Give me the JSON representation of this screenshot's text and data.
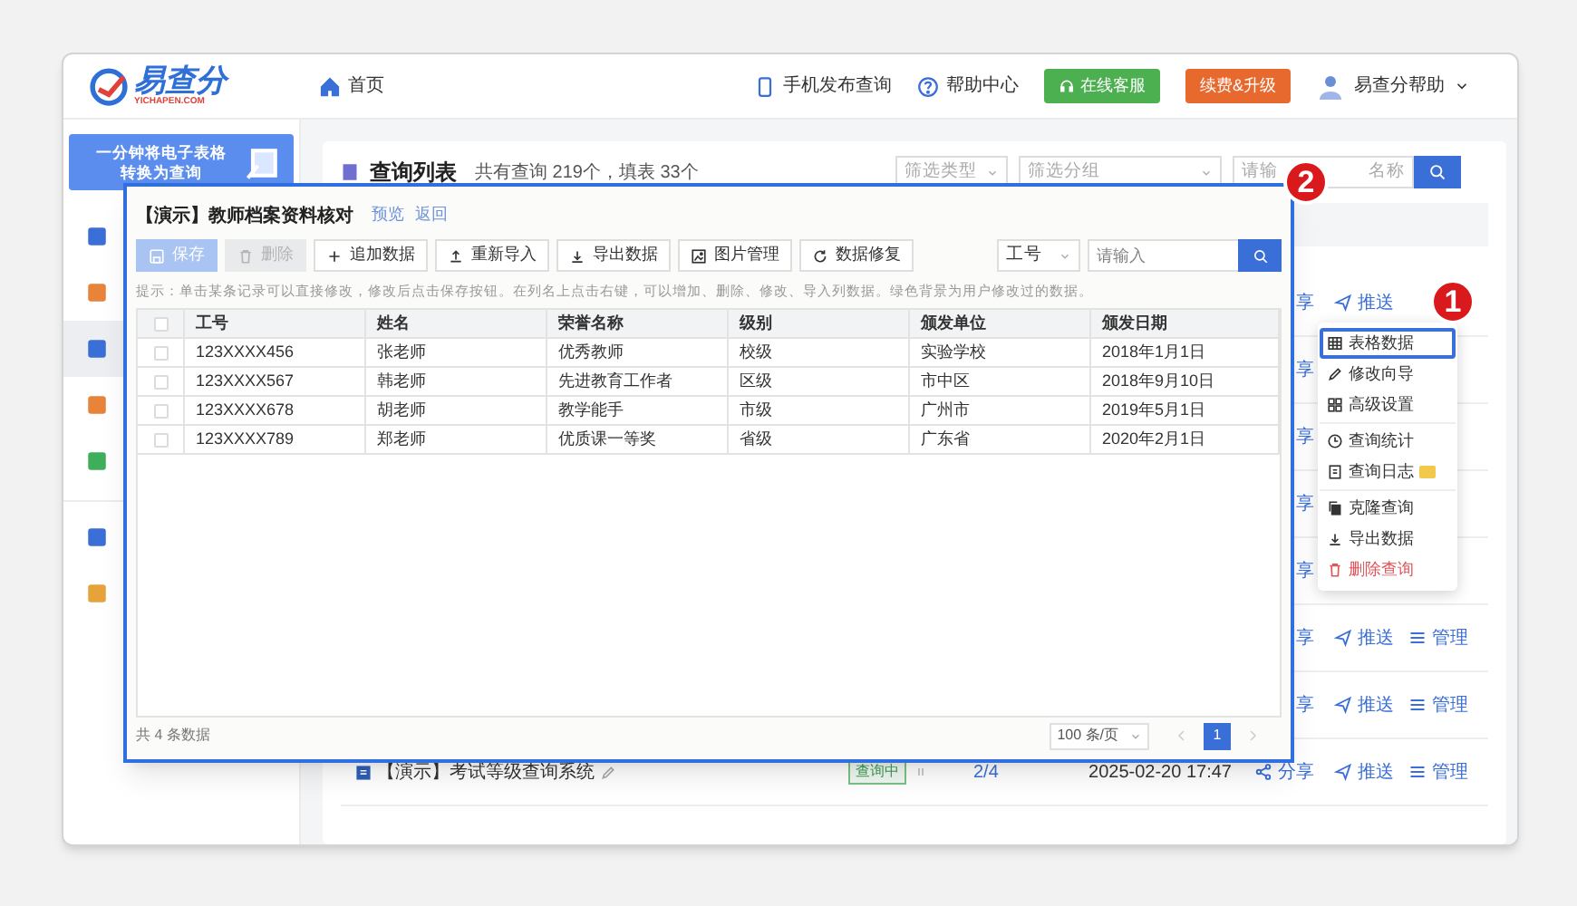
{
  "header": {
    "logo": "易查分",
    "logo_sub": "YICHAPEN.COM",
    "home": "首页",
    "links": [
      {
        "label": "手机发布查询",
        "kind": "phone"
      },
      {
        "label": "帮助中心",
        "kind": "help"
      }
    ],
    "buttons": [
      {
        "label": "在线客服",
        "kind": "service"
      },
      {
        "label": "续费&升级",
        "kind": "upgrade"
      }
    ],
    "user": "易查分帮助"
  },
  "sidebar": {
    "banner": [
      "一分钟将电子表格",
      "转换为查询"
    ],
    "groups": [
      [
        {
          "selected": false,
          "color": "#3b6fd8"
        },
        {
          "selected": false,
          "color": "#e8833a"
        },
        {
          "selected": true,
          "color": "#3b6fd8"
        },
        {
          "selected": false,
          "color": "#e8833a"
        },
        {
          "selected": false,
          "color": "#3fae5a"
        }
      ],
      [
        {
          "selected": false,
          "color": "#3b6fd8"
        },
        {
          "selected": false,
          "color": "#e8a23a"
        }
      ]
    ]
  },
  "list": {
    "title": "查询列表",
    "summary": "共有查询 219个，填表 33个",
    "filters": [
      "筛选类型",
      "筛选分组"
    ],
    "search_placeholder": [
      "请输",
      "名称"
    ],
    "rows": [
      {
        "share": "享",
        "push": "推送"
      },
      {
        "share": "享"
      },
      {
        "share": "享"
      },
      {
        "share": "享"
      },
      {
        "share": "享"
      },
      {
        "share": "享",
        "push": "推送",
        "manage": "管理"
      },
      {
        "share": "享",
        "push": "推送",
        "manage": "管理"
      },
      {
        "title": "【演示】考试等级查询系统",
        "status": "查询中",
        "count": "2/4",
        "time": "2025-02-20 17:47",
        "share": "分享",
        "push": "推送",
        "manage": "管理"
      }
    ]
  },
  "modal": {
    "title": "【演示】教师档案资料核对",
    "links": [
      "预览",
      "返回"
    ],
    "toolbar": [
      {
        "label": "保存",
        "kind": "save",
        "disabled": true
      },
      {
        "label": "删除",
        "kind": "delete",
        "disabled": true
      },
      {
        "label": "追加数据",
        "kind": "add",
        "disabled": false
      },
      {
        "label": "重新导入",
        "kind": "import",
        "disabled": false
      },
      {
        "label": "导出数据",
        "kind": "export",
        "disabled": false
      },
      {
        "label": "图片管理",
        "kind": "image",
        "disabled": false
      },
      {
        "label": "数据修复",
        "kind": "repair",
        "disabled": false
      }
    ],
    "search_field": "工号",
    "search_placeholder": "请输入",
    "hint": "提示：单击某条记录可以直接修改，修改后点击保存按钮。在列名上点击右键，可以增加、删除、修改、导入列数据。绿色背景为用户修改过的数据。",
    "all_checked": false,
    "columns": [
      "工号",
      "姓名",
      "荣誉名称",
      "级别",
      "颁发单位",
      "颁发日期"
    ],
    "rows": [
      {
        "checked": false,
        "cells": [
          "123XXXX456",
          "张老师",
          "优秀教师",
          "校级",
          "实验学校",
          "2018年1月1日"
        ]
      },
      {
        "checked": false,
        "cells": [
          "123XXXX567",
          "韩老师",
          "先进教育工作者",
          "区级",
          "市中区",
          "2018年9月10日"
        ]
      },
      {
        "checked": false,
        "cells": [
          "123XXXX678",
          "胡老师",
          "教学能手",
          "市级",
          "广州市",
          "2019年5月1日"
        ]
      },
      {
        "checked": false,
        "cells": [
          "123XXXX789",
          "郑老师",
          "优质课一等奖",
          "省级",
          "广东省",
          "2020年2月1日"
        ]
      }
    ],
    "total": "共 4 条数据",
    "page_size": "100 条/页",
    "pages": [
      {
        "label": "1",
        "selected": true
      }
    ]
  },
  "menu": {
    "groups": [
      [
        {
          "label": "表格数据",
          "kind": "table",
          "selected": true,
          "tag": false
        },
        {
          "label": "修改向导",
          "kind": "edit",
          "selected": false,
          "tag": false
        },
        {
          "label": "高级设置",
          "kind": "settings",
          "selected": false,
          "tag": false
        }
      ],
      [
        {
          "label": "查询统计",
          "kind": "stats",
          "selected": false,
          "tag": false
        },
        {
          "label": "查询日志",
          "kind": "log",
          "selected": false,
          "tag": true
        }
      ],
      [
        {
          "label": "克隆查询",
          "kind": "clone",
          "selected": false,
          "tag": false
        },
        {
          "label": "导出数据",
          "kind": "export",
          "selected": false,
          "tag": false
        },
        {
          "label": "删除查询",
          "kind": "delete",
          "selected": false,
          "tag": false
        }
      ]
    ]
  },
  "callouts": [
    "1",
    "2"
  ]
}
